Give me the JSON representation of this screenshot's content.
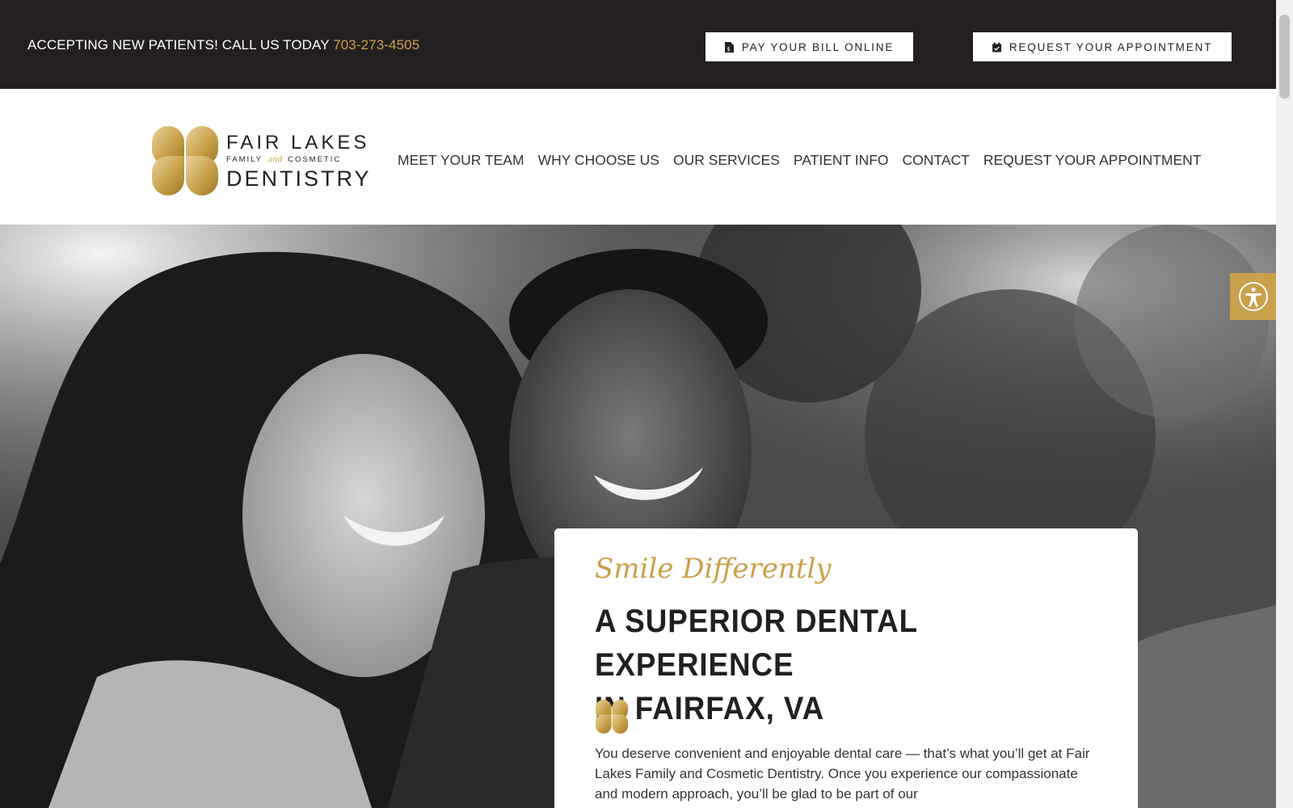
{
  "topbar": {
    "promo_text": "ACCEPTING NEW PATIENTS! CALL US TODAY",
    "phone": "703-273-4505",
    "pay_bill_label": "PAY YOUR BILL ONLINE",
    "appointment_label": "REQUEST YOUR APPOINTMENT",
    "pay_icon": "document-dollar-icon",
    "appointment_icon": "calendar-check-icon"
  },
  "logo": {
    "line1": "FAIR LAKES",
    "line2_left": "FAMILY",
    "line2_and": "and",
    "line2_right": "COSMETIC",
    "line3": "DENTISTRY",
    "icon": "four-leaf-clover-icon"
  },
  "nav": {
    "items": [
      {
        "label": "MEET YOUR TEAM"
      },
      {
        "label": "WHY CHOOSE US"
      },
      {
        "label": "OUR SERVICES"
      },
      {
        "label": "PATIENT INFO"
      },
      {
        "label": "CONTACT"
      },
      {
        "label": "REQUEST YOUR APPOINTMENT"
      }
    ]
  },
  "hero": {
    "tagline": "Smile Differently",
    "headline_line1": "A SUPERIOR DENTAL EXPERIENCE",
    "headline_line2": "IN FAIRFAX, VA",
    "body": "You deserve convenient and enjoyable dental care — that’s what you’ll get at Fair Lakes Family and Cosmetic Dentistry. Once you experience our compassionate and modern approach, you’ll be glad to be part of our",
    "image_description_icon": "photo-couple-smiling"
  },
  "accessibility": {
    "icon": "accessibility-icon"
  },
  "colors": {
    "topbar_bg": "#231f20",
    "accent_gold": "#c9a14a",
    "text_dark": "#231f20"
  }
}
